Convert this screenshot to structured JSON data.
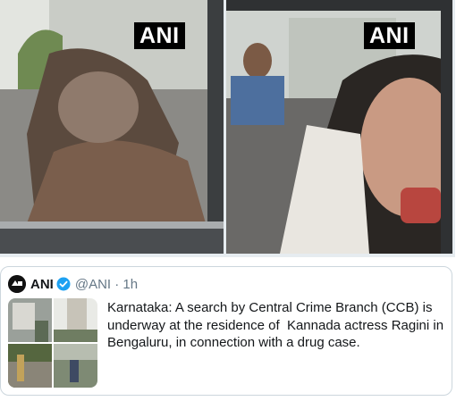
{
  "media": {
    "left_logo": "ANI",
    "right_logo": "ANI"
  },
  "quoted_tweet": {
    "name": "ANI",
    "handle_time": "@ANI · 1h",
    "text": "Karnataka: A search by Central Crime Branch (CCB) is\nunderway at the residence of  Kannada actress Ragini in\nBengaluru, in connection with a drug case."
  },
  "colors": {
    "verified": "#1da1f2",
    "handle": "#657786",
    "border": "#ccd6dd"
  }
}
